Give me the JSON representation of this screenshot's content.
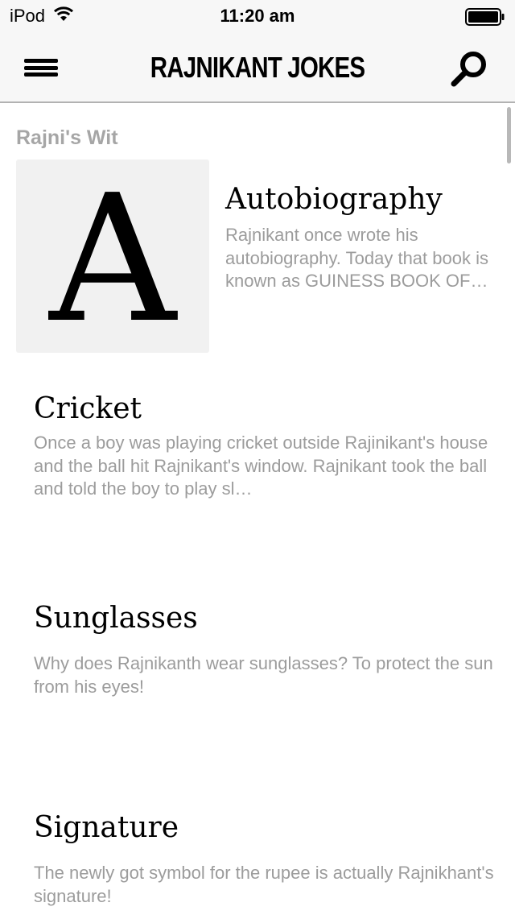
{
  "status_bar": {
    "carrier": "iPod",
    "time": "11:20 am"
  },
  "nav_bar": {
    "title": "RAJNIKANT JOKES",
    "menu_icon": "hamburger-menu-icon",
    "search_icon": "search-icon"
  },
  "section": {
    "header": "Rajni's Wit"
  },
  "jokes": [
    {
      "thumbnail_letter": "A",
      "title": "Autobiography",
      "snippet": "Rajnikant once wrote his autobiography. Today that book is known as GUINESS BOOK OF WORLD RECORDS."
    },
    {
      "title": "Cricket",
      "snippet": "Once a boy was playing cricket outside Rajinikant's house and the ball hit Rajnikant's window. Rajnikant took the ball and told the boy to play sl…"
    },
    {
      "title": "Sunglasses",
      "snippet": "Why does Rajnikanth wear sunglasses? To protect the sun from his eyes!"
    },
    {
      "title": "Signature",
      "snippet": "The newly got symbol for the rupee is actually Rajnikhant's signature!"
    }
  ],
  "colors": {
    "bar_background": "#f7f7f7",
    "snippet_text": "#9c9c9c",
    "section_header": "#a6a6a6",
    "thumbnail_background": "#f1f1f1"
  }
}
